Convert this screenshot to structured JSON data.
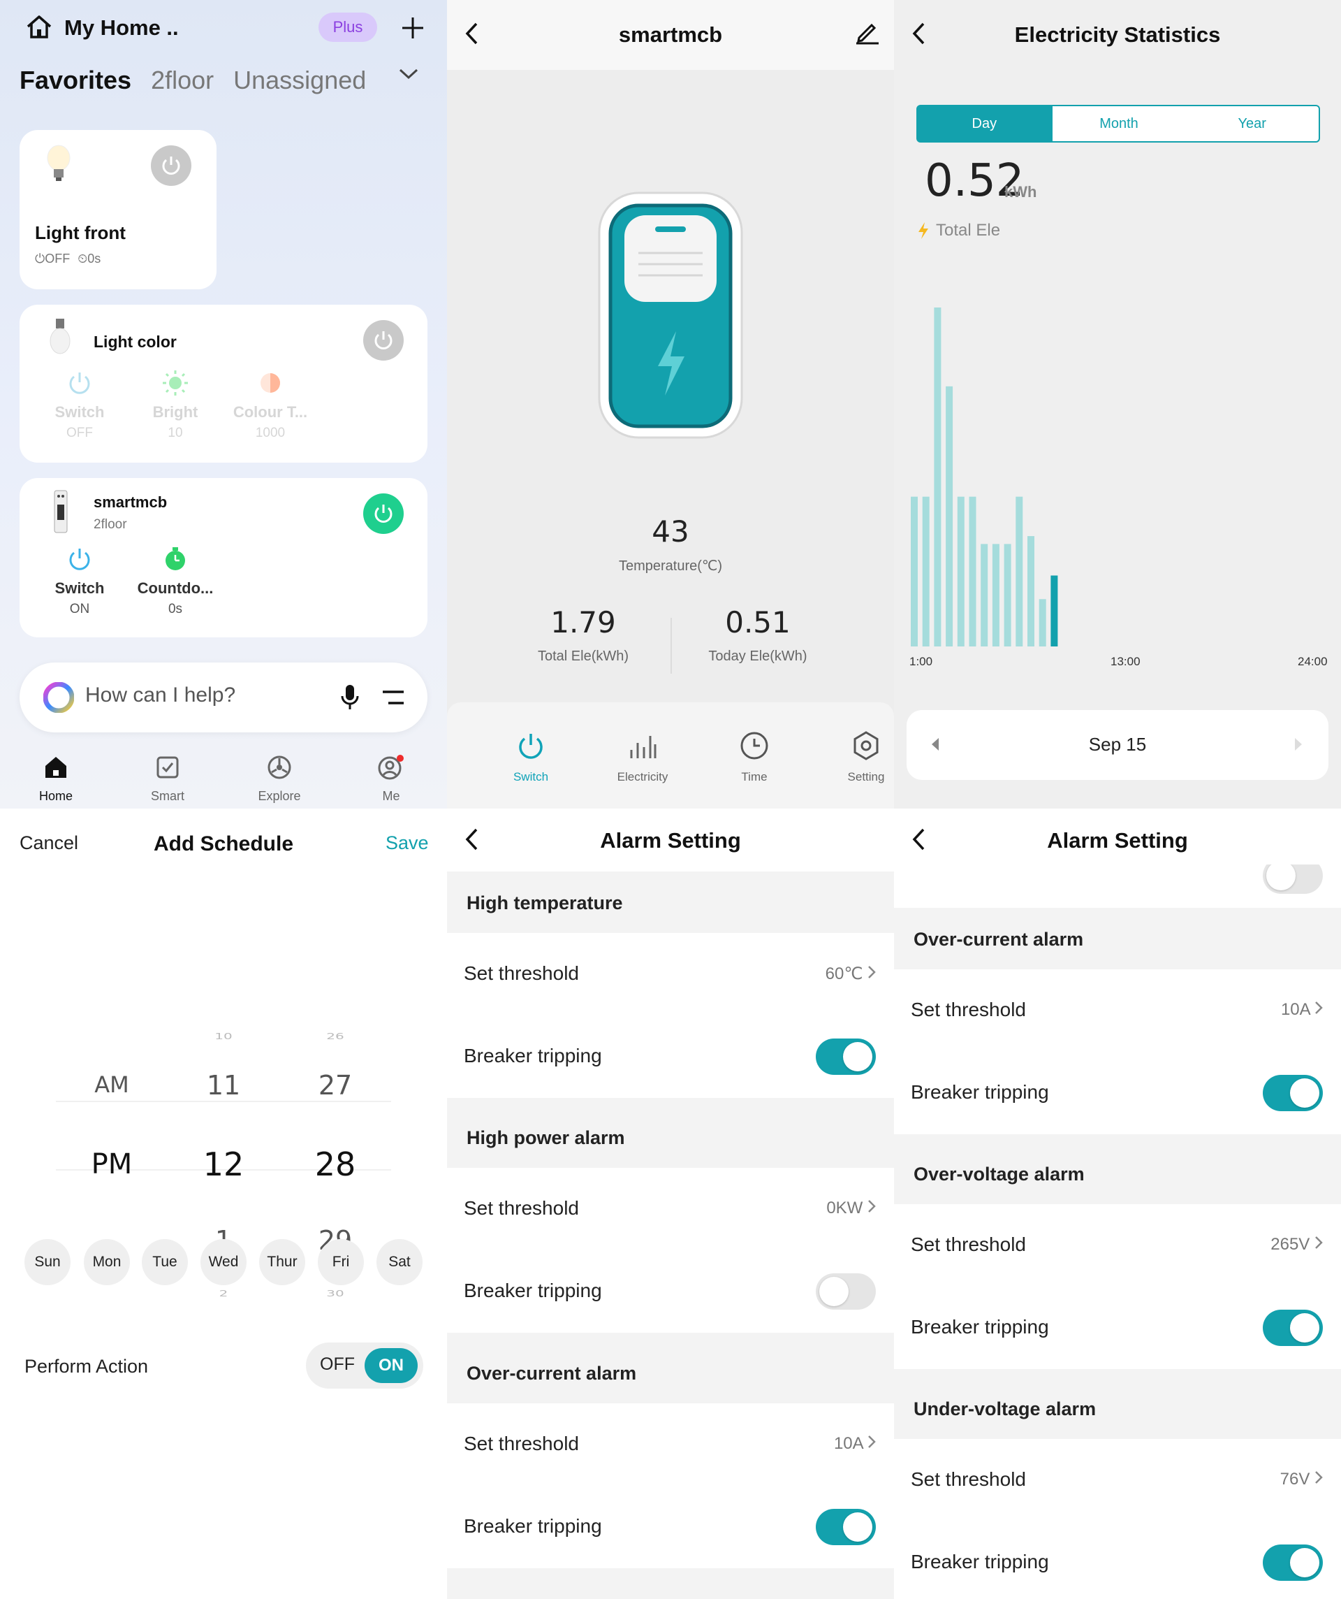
{
  "home": {
    "title": "My Home ..",
    "plus_badge": "Plus",
    "tabs": [
      "Favorites",
      "2floor",
      "Unassigned"
    ],
    "devices": {
      "light_front": {
        "name": "Light front",
        "status": "⏻OFF",
        "timer": "⏲0s"
      },
      "light_color": {
        "name": "Light color",
        "controls": [
          {
            "label": "Switch",
            "value": "OFF"
          },
          {
            "label": "Bright",
            "value": "10"
          },
          {
            "label": "Colour T...",
            "value": "1000"
          }
        ]
      },
      "smartmcb": {
        "name": "smartmcb",
        "room": "2floor",
        "controls": [
          {
            "label": "Switch",
            "value": "ON"
          },
          {
            "label": "Countdo...",
            "value": "0s"
          }
        ]
      }
    },
    "assistant_placeholder": "How can I help?",
    "nav": [
      "Home",
      "Smart",
      "Explore",
      "Me"
    ]
  },
  "device": {
    "title": "smartmcb",
    "temperature": "43",
    "temperature_label": "Temperature(℃)",
    "total_ele": "1.79",
    "total_ele_label": "Total Ele(kWh)",
    "today_ele": "0.51",
    "today_ele_label": "Today Ele(kWh)",
    "tabs": [
      "Switch",
      "Electricity",
      "Time",
      "Setting"
    ]
  },
  "stats": {
    "title": "Electricity Statistics",
    "periods": [
      "Day",
      "Month",
      "Year"
    ],
    "value": "0.52",
    "unit": "kWh",
    "value_label": "Total Ele",
    "date": "Sep 15"
  },
  "chart_data": {
    "type": "bar",
    "x_tick_labels": [
      "1:00",
      "13:00",
      "24:00"
    ],
    "values": [
      0.19,
      0.19,
      0.43,
      0.33,
      0.19,
      0.19,
      0.13,
      0.13,
      0.13,
      0.19,
      0.14,
      0.06,
      0.09
    ],
    "highlight_index": 12,
    "grid": false,
    "colors": {
      "bar": "#a5dcdc",
      "highlight": "#13a1ad"
    }
  },
  "schedule": {
    "cancel": "Cancel",
    "title": "Add Schedule",
    "save": "Save",
    "picker": {
      "ampm": [
        "AM",
        "PM"
      ],
      "hours": [
        "10",
        "11",
        "12",
        "1",
        "2"
      ],
      "minutes": [
        "26",
        "27",
        "28",
        "29",
        "30"
      ],
      "selected": {
        "ampm": "PM",
        "hour": "12",
        "minute": "28"
      }
    },
    "days": [
      "Sun",
      "Mon",
      "Tue",
      "Wed",
      "Thur",
      "Fri",
      "Sat"
    ],
    "perform_label": "Perform Action",
    "off": "OFF",
    "on": "ON"
  },
  "alarm1": {
    "title": "Alarm Setting",
    "sections": [
      {
        "name": "High temperature",
        "threshold": "60℃",
        "tripping": true
      },
      {
        "name": "High power alarm",
        "threshold": "0KW",
        "tripping": false
      },
      {
        "name": "Over-current alarm",
        "threshold": "10A",
        "tripping": true
      }
    ],
    "row_threshold": "Set threshold",
    "row_tripping": "Breaker tripping"
  },
  "alarm2": {
    "title": "Alarm Setting",
    "sections": [
      {
        "name": "Over-current alarm",
        "threshold": "10A",
        "tripping": true
      },
      {
        "name": "Over-voltage alarm",
        "threshold": "265V",
        "tripping": true
      },
      {
        "name": "Under-voltage alarm",
        "threshold": "76V",
        "tripping": true
      }
    ],
    "row_threshold": "Set threshold",
    "row_tripping": "Breaker tripping"
  },
  "colors": {
    "accent": "#13a1ad",
    "on_green": "#1fcf8e",
    "plus_purple": "#8b3fe0"
  }
}
